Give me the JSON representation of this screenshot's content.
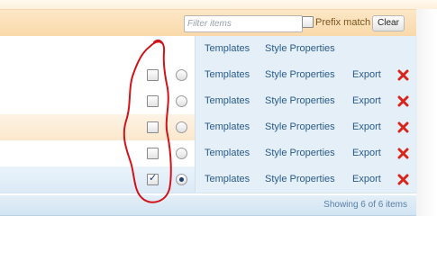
{
  "filter": {
    "placeholder": "Filter items",
    "value": "",
    "prefix_match_label": "Prefix match",
    "prefix_match_checked": false,
    "clear_label": "Clear"
  },
  "header_row": {
    "templates_label": "Templates",
    "style_properties_label": "Style Properties"
  },
  "rows": [
    {
      "checked": false,
      "radio_selected": false,
      "templates": "Templates",
      "style_properties": "Style Properties",
      "export": "Export",
      "delete_icon": "red-x-delete-icon"
    },
    {
      "checked": false,
      "radio_selected": false,
      "templates": "Templates",
      "style_properties": "Style Properties",
      "export": "Export",
      "delete_icon": "red-x-delete-icon"
    },
    {
      "checked": false,
      "radio_selected": false,
      "templates": "Templates",
      "style_properties": "Style Properties",
      "export": "Export",
      "delete_icon": "red-x-delete-icon"
    },
    {
      "checked": false,
      "radio_selected": false,
      "templates": "Templates",
      "style_properties": "Style Properties",
      "export": "Export",
      "delete_icon": "red-x-delete-icon"
    },
    {
      "checked": true,
      "radio_selected": true,
      "templates": "Templates",
      "style_properties": "Style Properties",
      "export": "Export",
      "delete_icon": "red-x-delete-icon"
    }
  ],
  "footer": {
    "status": "Showing 6 of 6 items"
  },
  "colors": {
    "link": "#2a5a8a",
    "delete": "#d9241c",
    "annotation": "#d0141a"
  }
}
